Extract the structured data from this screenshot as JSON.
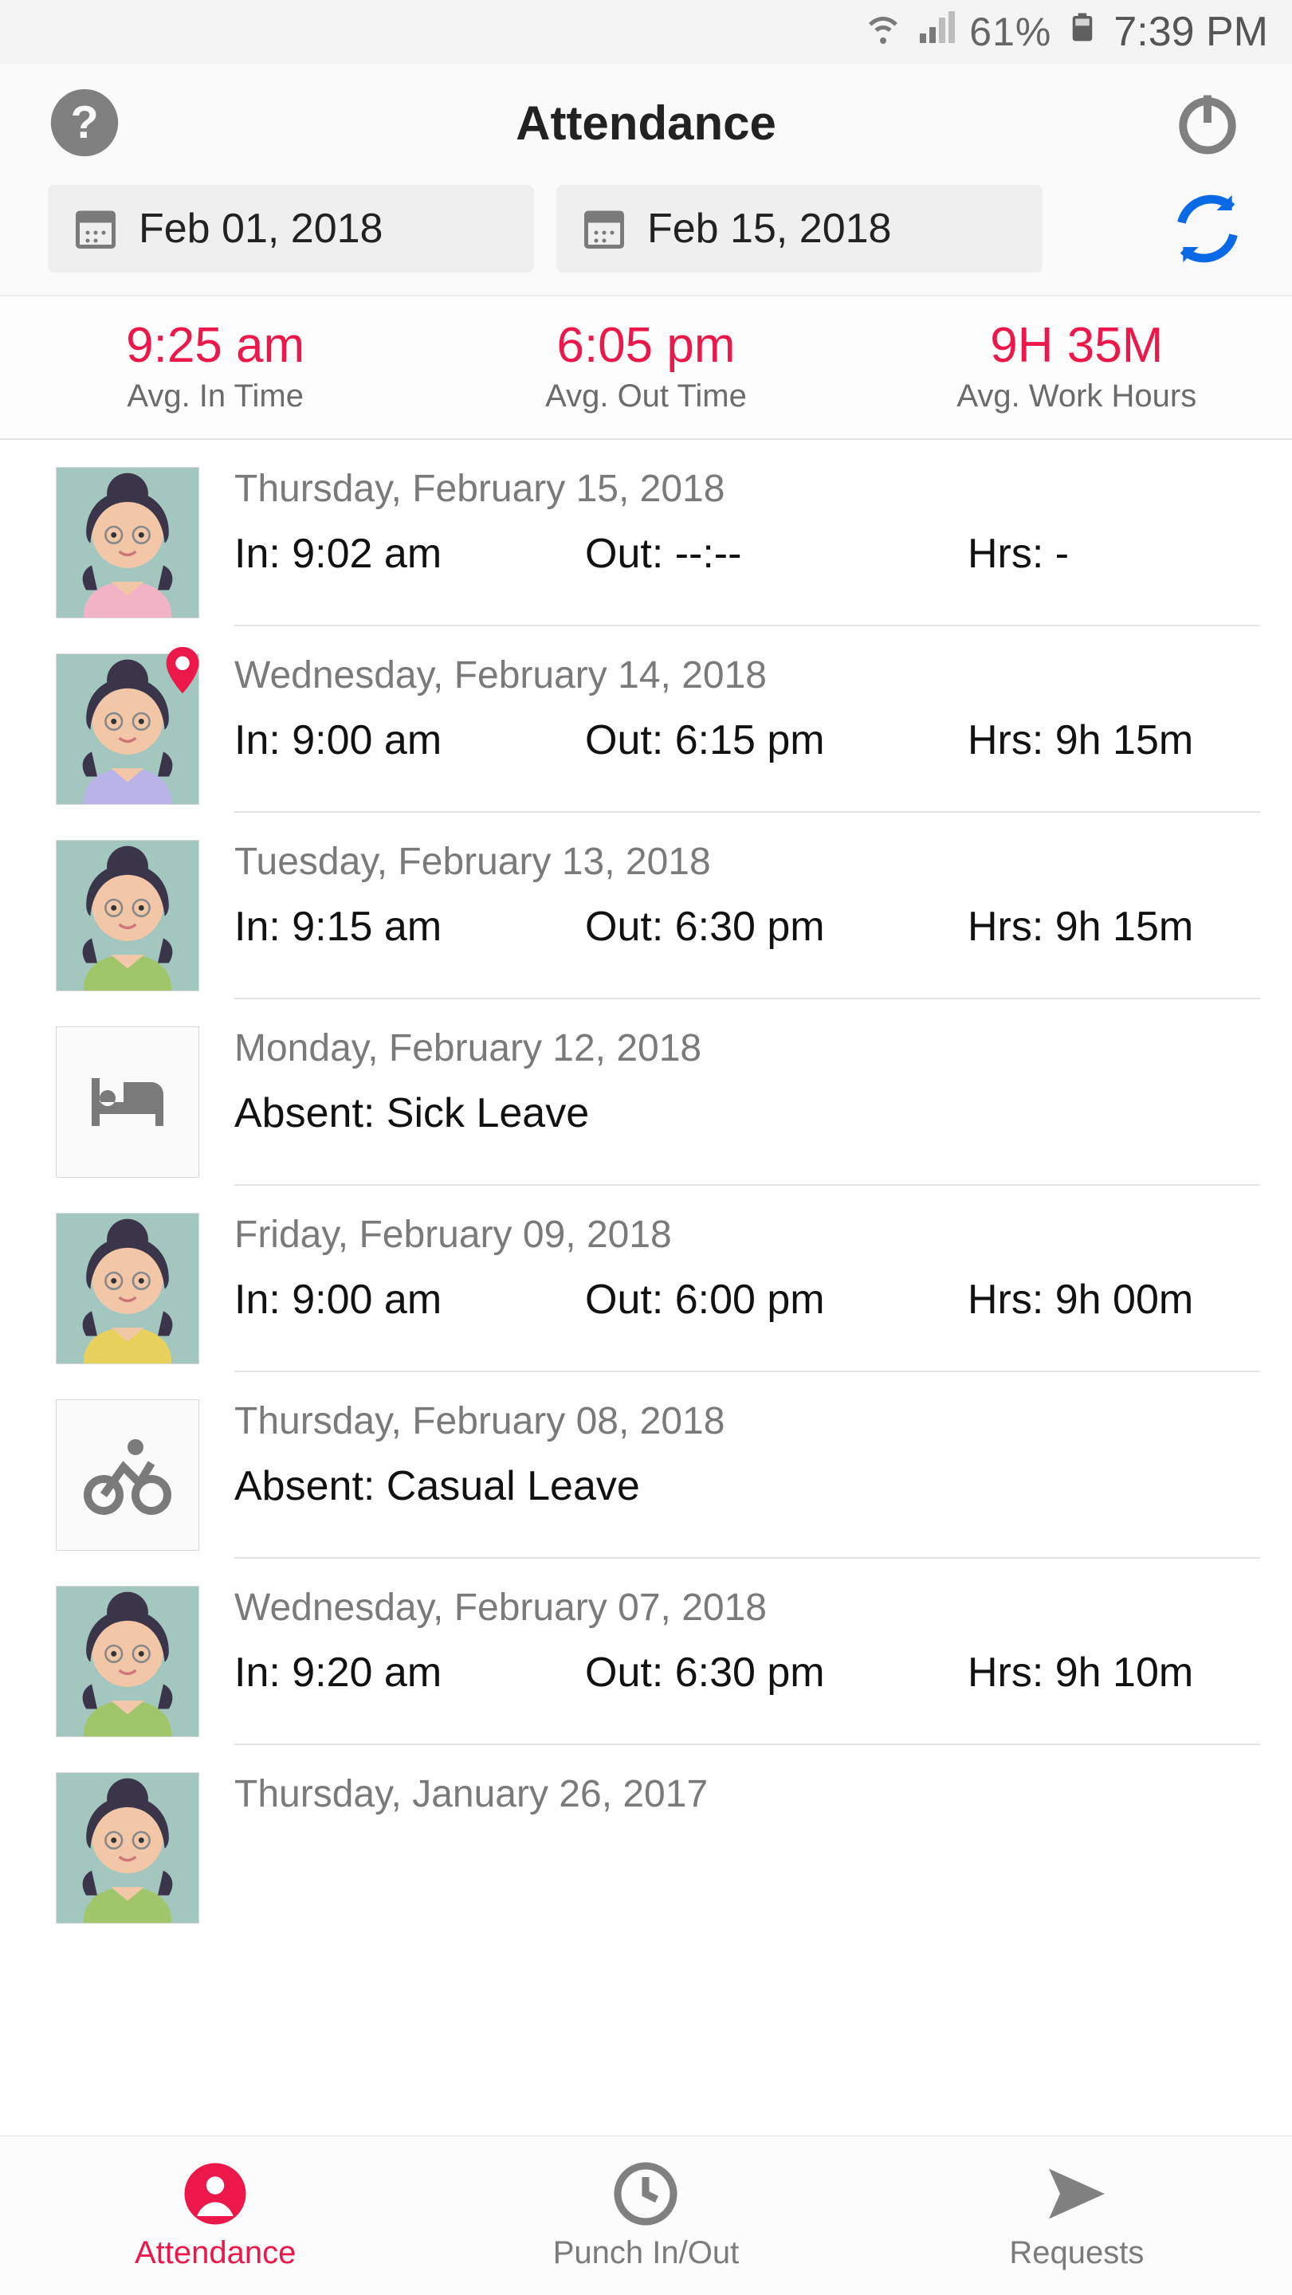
{
  "status": {
    "battery_pct": "61%",
    "time": "7:39 PM"
  },
  "header": {
    "title": "Attendance",
    "help_icon": "help-icon",
    "power_icon": "power-icon",
    "date_from": "Feb 01, 2018",
    "date_to": "Feb 15, 2018",
    "refresh_icon": "refresh-icon"
  },
  "stats": {
    "in": {
      "value": "9:25 am",
      "label": "Avg. In Time"
    },
    "out": {
      "value": "6:05 pm",
      "label": "Avg. Out Time"
    },
    "hours": {
      "value": "9H 35M",
      "label": "Avg. Work Hours"
    }
  },
  "labels": {
    "in_prefix": "In: ",
    "out_prefix": "Out: ",
    "hrs_prefix": "Hrs: ",
    "absent_prefix": "Absent: "
  },
  "entries": [
    {
      "date": "Thursday, February 15, 2018",
      "type": "present",
      "avatar_shirt": "#f3b3c7",
      "in": "9:02 am",
      "out": "--:--",
      "hrs": "-",
      "has_pin": false
    },
    {
      "date": "Wednesday, February 14, 2018",
      "type": "present",
      "avatar_shirt": "#b9b3e8",
      "in": "9:00 am",
      "out": "6:15 pm",
      "hrs": "9h 15m",
      "has_pin": true
    },
    {
      "date": "Tuesday, February 13, 2018",
      "type": "present",
      "avatar_shirt": "#9fc66b",
      "in": "9:15 am",
      "out": "6:30 pm",
      "hrs": "9h 15m",
      "has_pin": false
    },
    {
      "date": "Monday, February 12, 2018",
      "type": "absent",
      "reason": "Sick Leave",
      "icon": "bed-icon"
    },
    {
      "date": "Friday, February 09, 2018",
      "type": "present",
      "avatar_shirt": "#e7d15a",
      "in": "9:00 am",
      "out": "6:00 pm",
      "hrs": "9h 00m",
      "has_pin": false
    },
    {
      "date": "Thursday, February 08, 2018",
      "type": "absent",
      "reason": "Casual Leave",
      "icon": "bike-icon"
    },
    {
      "date": "Wednesday, February 07, 2018",
      "type": "present",
      "avatar_shirt": "#9fc66b",
      "in": "9:20 am",
      "out": "6:30 pm",
      "hrs": "9h 10m",
      "has_pin": false
    },
    {
      "date": "Thursday, January 26, 2017",
      "type": "present",
      "avatar_shirt": "#9fc66b",
      "in": "",
      "out": "",
      "hrs": "",
      "has_pin": false
    }
  ],
  "tabs": {
    "attendance": "Attendance",
    "punch": "Punch In/Out",
    "requests": "Requests"
  }
}
